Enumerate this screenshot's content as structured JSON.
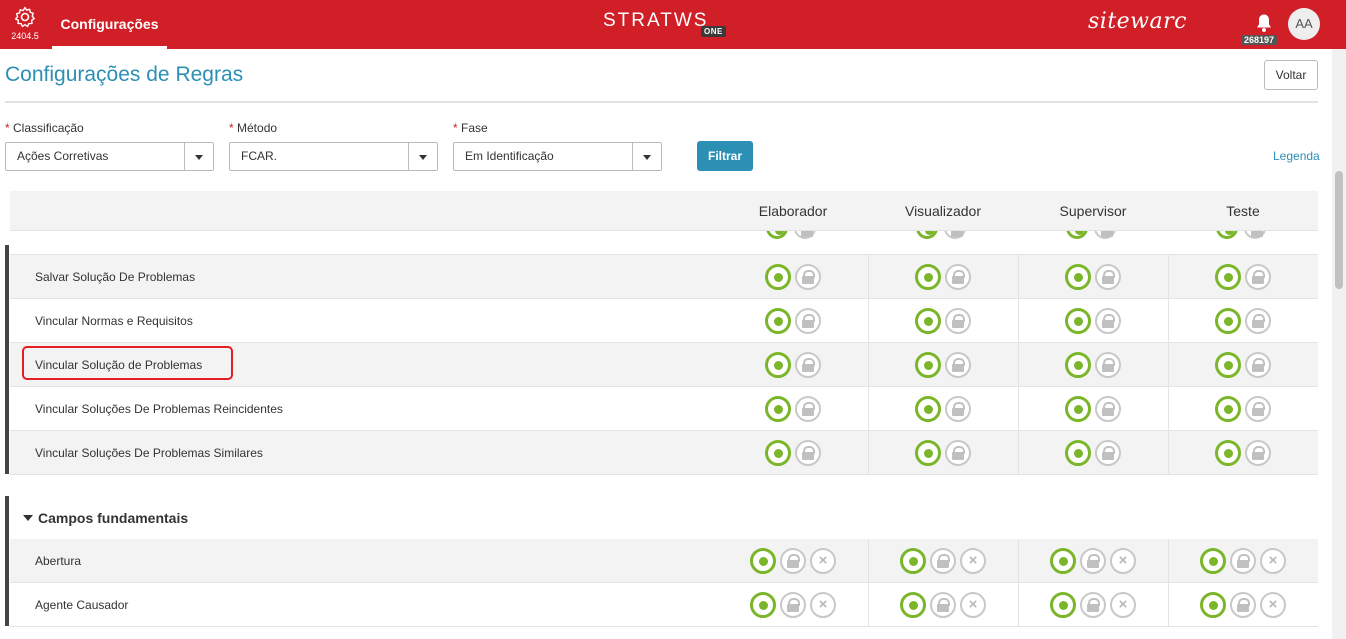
{
  "topbar": {
    "version": "2404.5",
    "nav_label": "Configurações",
    "brand": "STRATWS",
    "brand_suffix": "ONE",
    "vendor": "sitewarc",
    "notification_count": "268197",
    "avatar_initials": "AA",
    "accent_color": "#d11f27"
  },
  "header": {
    "title": "Configurações de Regras",
    "back_label": "Voltar"
  },
  "filters": {
    "classificacao": {
      "label": "Classificação",
      "required_mark": "*",
      "value": "Ações Corretivas"
    },
    "metodo": {
      "label": "Método",
      "required_mark": "*",
      "value": "FCAR."
    },
    "fase": {
      "label": "Fase",
      "required_mark": "*",
      "value": "Em Identificação"
    },
    "filter_label": "Filtrar",
    "legend_label": "Legenda"
  },
  "table": {
    "columns": [
      "Elaborador",
      "Visualizador",
      "Supervisor",
      "Teste"
    ],
    "rows": [
      {
        "name": "Salvar Solução De Problemas"
      },
      {
        "name": "Vincular Normas e Requisitos"
      },
      {
        "name": "Vincular Solução de Problemas"
      },
      {
        "name": "Vincular Soluções De Problemas Reincidentes"
      },
      {
        "name": "Vincular Soluções De Problemas Similares"
      }
    ],
    "group": {
      "title": "Campos fundamentais",
      "rows": [
        {
          "name": "Abertura"
        },
        {
          "name": "Agente Causador"
        }
      ]
    }
  },
  "icons": {
    "edit": "edit-icon",
    "lock": "lock-icon",
    "delete": "close-icon",
    "edit_color": "#7bb52a",
    "disabled_color": "#c8c8c8"
  }
}
